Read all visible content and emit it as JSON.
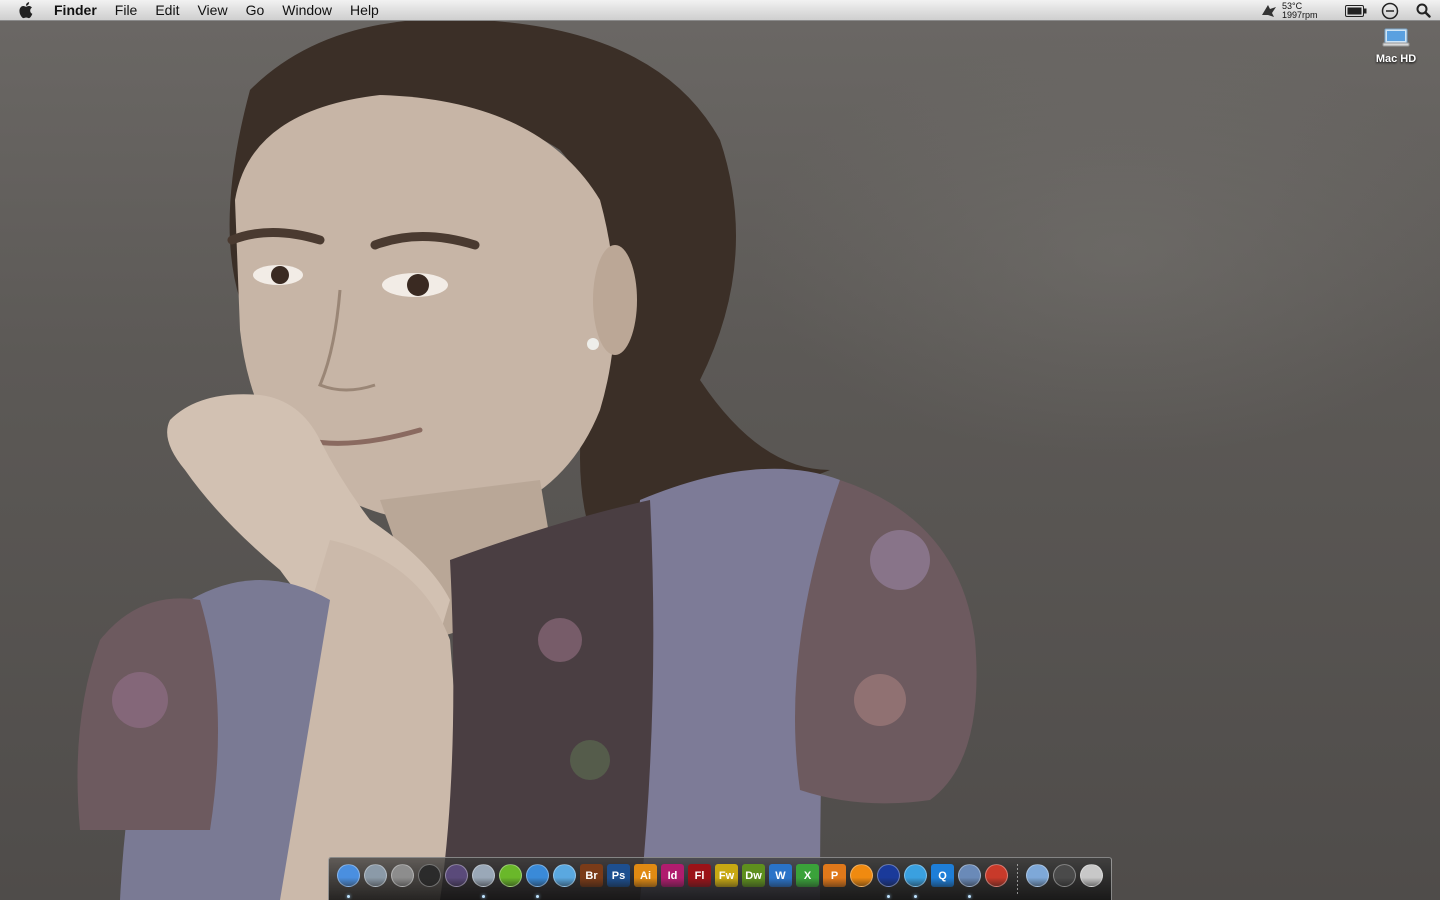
{
  "menubar": {
    "app_name": "Finder",
    "menus": [
      "File",
      "Edit",
      "View",
      "Go",
      "Window",
      "Help"
    ],
    "temperature": "53°C",
    "fan_speed": "1997rpm"
  },
  "desktop": {
    "icons": [
      {
        "label": "Mac HD",
        "icon": "hard-drive-icon"
      }
    ],
    "wallpaper": "portrait-photo"
  },
  "dock": {
    "apps": [
      {
        "name": "Finder",
        "icon": "finder-icon",
        "text": "",
        "color": "#4a8fe0",
        "running": true
      },
      {
        "name": "Preview",
        "icon": "preview-icon",
        "text": "",
        "color": "#8b9aa8",
        "running": false
      },
      {
        "name": "System Preferences",
        "icon": "system-preferences-icon",
        "text": "",
        "color": "#8d8d8d",
        "running": false
      },
      {
        "name": "Dashboard",
        "icon": "dashboard-icon",
        "text": "",
        "color": "#2b2b2b",
        "running": false
      },
      {
        "name": "Mac OS X",
        "icon": "mac-os-x-icon",
        "text": "",
        "color": "#5a4a7a",
        "running": false
      },
      {
        "name": "Network Utility",
        "icon": "network-icon",
        "text": "",
        "color": "#9aa8b8",
        "running": true
      },
      {
        "name": "Chat",
        "icon": "chat-icon",
        "text": "",
        "color": "#6ab82a",
        "running": false
      },
      {
        "name": "Safari",
        "icon": "safari-icon",
        "text": "",
        "color": "#3a8ad8",
        "running": true
      },
      {
        "name": "iTunes",
        "icon": "itunes-icon",
        "text": "",
        "color": "#5aa8e0",
        "running": false
      },
      {
        "name": "Bridge",
        "icon": "bridge-icon",
        "text": "Br",
        "color": "#7a3b18",
        "running": false
      },
      {
        "name": "Photoshop",
        "icon": "photoshop-icon",
        "text": "Ps",
        "color": "#1d4f8f",
        "running": false
      },
      {
        "name": "Illustrator",
        "icon": "illustrator-icon",
        "text": "Ai",
        "color": "#e08a12",
        "running": false
      },
      {
        "name": "InDesign",
        "icon": "indesign-icon",
        "text": "Id",
        "color": "#b01c6e",
        "running": false
      },
      {
        "name": "Flash",
        "icon": "flash-icon",
        "text": "Fl",
        "color": "#9b1218",
        "running": false
      },
      {
        "name": "Fireworks",
        "icon": "fireworks-icon",
        "text": "Fw",
        "color": "#c8a812",
        "running": false
      },
      {
        "name": "Dreamweaver",
        "icon": "dreamweaver-icon",
        "text": "Dw",
        "color": "#5e8f1e",
        "running": false
      },
      {
        "name": "Word",
        "icon": "word-icon",
        "text": "W",
        "color": "#2a73c8",
        "running": false
      },
      {
        "name": "Excel",
        "icon": "excel-icon",
        "text": "X",
        "color": "#3aa23a",
        "running": false
      },
      {
        "name": "PowerPoint",
        "icon": "powerpoint-icon",
        "text": "P",
        "color": "#e0781a",
        "running": false
      },
      {
        "name": "VLC",
        "icon": "vlc-icon",
        "text": "",
        "color": "#f08a10",
        "running": false
      },
      {
        "name": "Xcode",
        "icon": "xcode-icon",
        "text": "",
        "color": "#1a3a9a",
        "running": true
      },
      {
        "name": "Messenger",
        "icon": "messenger-icon",
        "text": "",
        "color": "#3aa0e0",
        "running": true
      },
      {
        "name": "QuickTime",
        "icon": "quicktime-icon",
        "text": "Q",
        "color": "#1e7ed8",
        "running": false
      },
      {
        "name": "Preview Viewer",
        "icon": "image-viewer-icon",
        "text": "",
        "color": "#6a8ab8",
        "running": true
      },
      {
        "name": "Paintbrush",
        "icon": "paintbrush-icon",
        "text": "",
        "color": "#c83a2a",
        "running": false
      }
    ],
    "stacks": [
      {
        "name": "Applications",
        "icon": "applications-folder-icon",
        "color": "#7ea8d8"
      },
      {
        "name": "Documents",
        "icon": "documents-stack-icon",
        "color": "#4a4a4a"
      },
      {
        "name": "Trash",
        "icon": "trash-icon",
        "color": "#c8c8c8"
      }
    ]
  }
}
